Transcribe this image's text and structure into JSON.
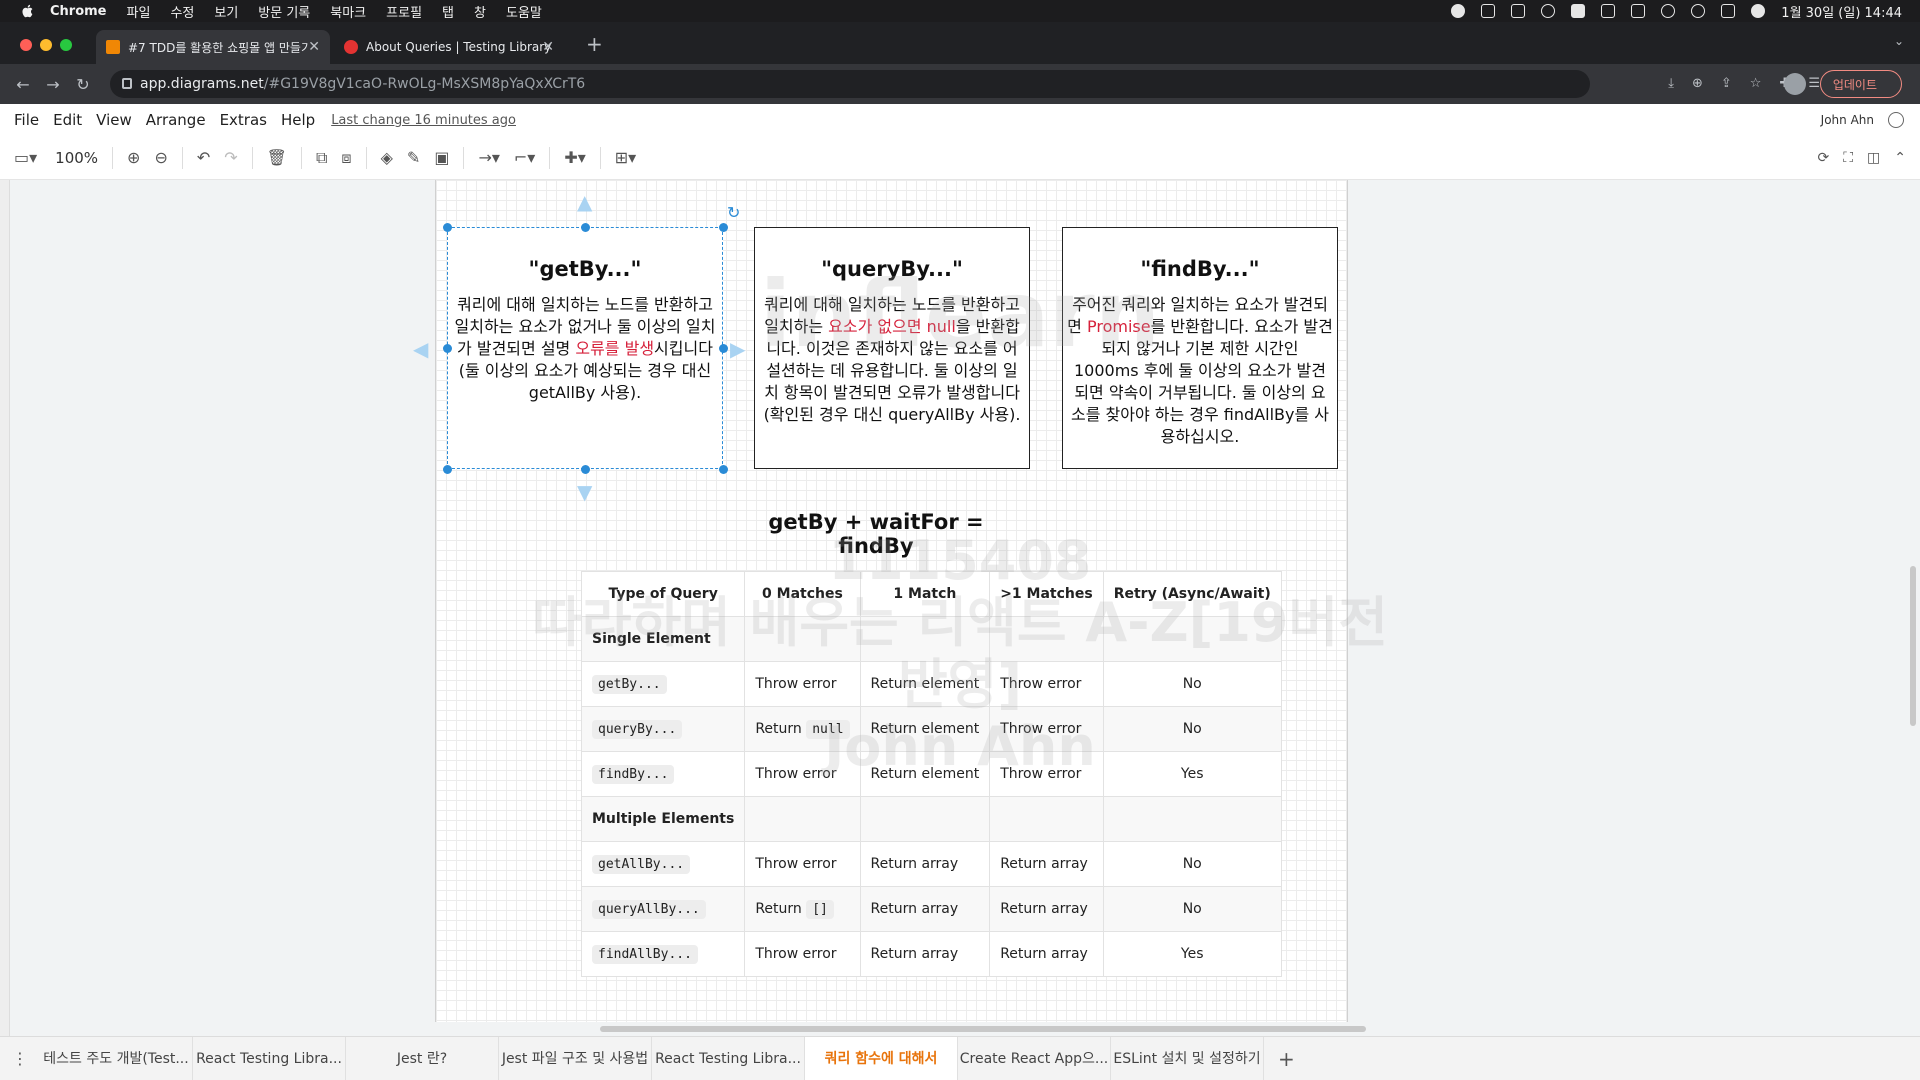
{
  "mac_menubar": {
    "items": [
      "Chrome",
      "파일",
      "수정",
      "보기",
      "방문 기록",
      "북마크",
      "프로필",
      "탭",
      "창",
      "도움말"
    ],
    "clock": "1월 30일 (일)  14:44"
  },
  "browser": {
    "tabs": [
      {
        "title": "#7 TDD를 활용한 쇼핑몰 앱 만들기",
        "active": true
      },
      {
        "title": "About Queries | Testing Library",
        "active": false
      }
    ],
    "url_host": "app.diagrams.net",
    "url_path": "/#G19V8gV1caO-RwOLg-MsXSM8pYaQxXCrT6",
    "update_button": "업데이트"
  },
  "app_menu": {
    "items": [
      "File",
      "Edit",
      "View",
      "Arrange",
      "Extras",
      "Help"
    ],
    "last_change": "Last change 16 minutes ago",
    "user": "John Ahn"
  },
  "toolbar": {
    "zoom": "100%"
  },
  "cards": [
    {
      "title": "\"getBy...\"",
      "text_before": "쿼리에 대해 일치하는 노드를 반환하고 일치하는 요소가 없거나 둘 이상의 일치가 발견되면 설명 ",
      "highlight": "오류를 발생",
      "text_after": "시킵니다(둘 이상의 요소가 예상되는 경우 대신 getAllBy 사용)."
    },
    {
      "title": "\"queryBy...\"",
      "text_before": "쿼리에 대해 일치하는 노드를 반환하고 일치하는 ",
      "highlight": "요소가 없으면 null",
      "text_after": "을 반환합니다. 이것은 존재하지 않는 요소를 어설션하는 데 유용합니다. 둘 이상의 일치 항목이 발견되면 오류가 발생합니다(확인된 경우 대신 queryAllBy 사용)."
    },
    {
      "title": "\"findBy...\"",
      "text_before": "주어진 쿼리와 일치하는 요소가 발견되면 ",
      "highlight": "Promise",
      "text_after": "를 반환합니다. 요소가 발견되지 않거나 기본 제한 시간인 1000ms 후에 둘 이상의 요소가 발견되면 약속이 거부됩니다. 둘 이상의 요소를 찾아야 하는 경우 findAllBy를 사용하십시오."
    }
  ],
  "formula": "getBy + waitFor = findBy",
  "table": {
    "headers": [
      "Type of Query",
      "0 Matches",
      "1 Match",
      ">1 Matches",
      "Retry (Async/Await)"
    ],
    "single_label": "Single Element",
    "single_rows": [
      {
        "query": "getBy...",
        "zero": "Throw error",
        "zero_code": "",
        "one": "Return element",
        "many": "Throw error",
        "retry": "No"
      },
      {
        "query": "queryBy...",
        "zero": "Return",
        "zero_code": "null",
        "one": "Return element",
        "many": "Throw error",
        "retry": "No"
      },
      {
        "query": "findBy...",
        "zero": "Throw error",
        "zero_code": "",
        "one": "Return element",
        "many": "Throw error",
        "retry": "Yes"
      }
    ],
    "multiple_label": "Multiple Elements",
    "multiple_rows": [
      {
        "query": "getAllBy...",
        "zero": "Throw error",
        "zero_code": "",
        "one": "Return array",
        "many": "Return array",
        "retry": "No"
      },
      {
        "query": "queryAllBy...",
        "zero": "Return",
        "zero_code": "[]",
        "one": "Return array",
        "many": "Return array",
        "retry": "No"
      },
      {
        "query": "findAllBy...",
        "zero": "Throw error",
        "zero_code": "",
        "one": "Return array",
        "many": "Return array",
        "retry": "Yes"
      }
    ]
  },
  "watermark": {
    "line1": "inflearn",
    "line2": "1115408",
    "line3": "따라하며 배우는 리액트 A-Z[19버전 반영]",
    "line4": "John Ahn"
  },
  "page_tabs": [
    "테스트 주도 개발(Test...",
    "React Testing Libra...",
    "Jest 란?",
    "Jest 파일 구조 및 사용법",
    "React Testing Libra...",
    "쿼리 함수에 대해서",
    "Create React App으...",
    "ESLint 설치 및 설정하기"
  ],
  "active_page_tab": 5,
  "colors": {
    "accent_red": "#d6213b",
    "selection_blue": "#2a8bd6",
    "active_tab_orange": "#e8740c"
  }
}
